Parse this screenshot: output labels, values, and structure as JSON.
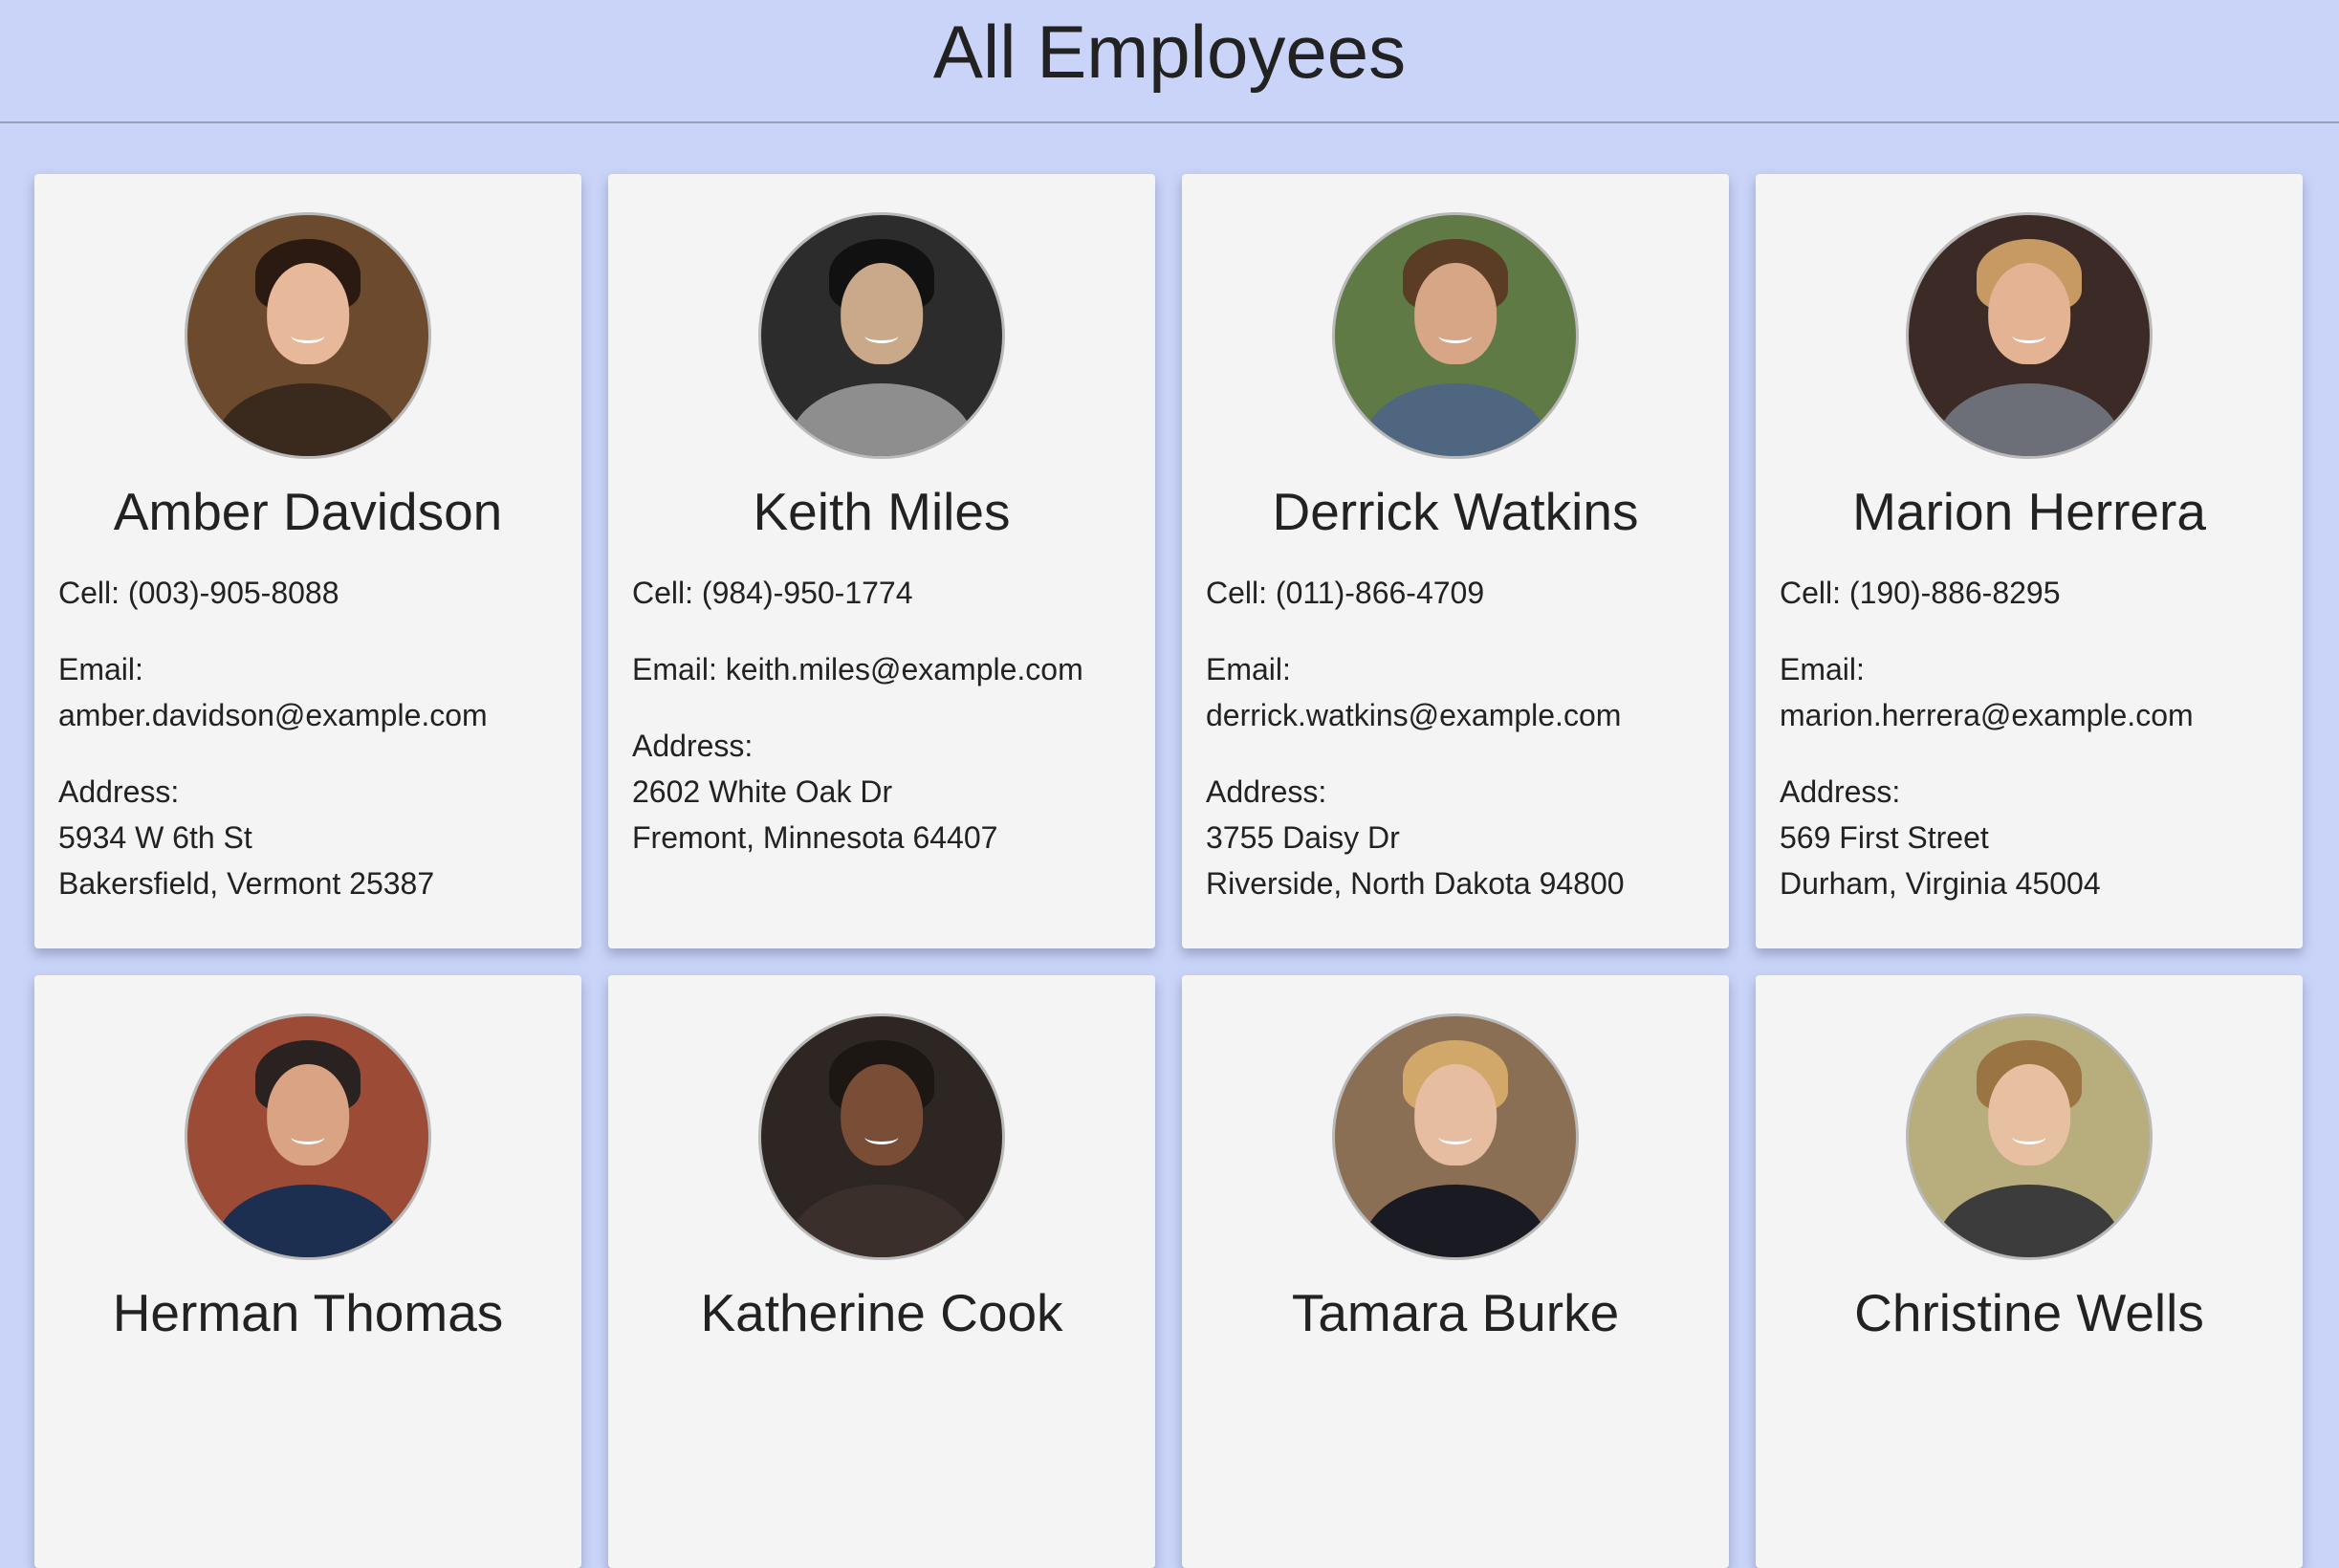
{
  "header": {
    "title": "All Employees"
  },
  "employees": [
    {
      "name": "Amber Davidson",
      "cell": "Cell: (003)-905-8088",
      "email_label": "Email:",
      "email": "amber.davidson@example.com",
      "email_break": true,
      "address_label": "Address:",
      "address_line1": "5934 W 6th St",
      "address_line2": "Bakersfield, Vermont 25387",
      "photo": {
        "bg": "#6b4a2e",
        "face": "#e7b89a",
        "hair": "#2b1a12",
        "body": "#3a2a1e"
      }
    },
    {
      "name": "Keith Miles",
      "cell": "Cell: (984)-950-1774",
      "email_label": "Email:",
      "email": "keith.miles@example.com",
      "email_break": false,
      "address_label": "Address:",
      "address_line1": "2602 White Oak Dr",
      "address_line2": "Fremont, Minnesota 64407",
      "photo": {
        "bg": "#2c2c2c",
        "face": "#c9a98a",
        "hair": "#111111",
        "body": "#8e8e8e"
      }
    },
    {
      "name": "Derrick Watkins",
      "cell": "Cell: (011)-866-4709",
      "email_label": "Email:",
      "email": "derrick.watkins@example.com",
      "email_break": true,
      "address_label": "Address:",
      "address_line1": "3755 Daisy Dr",
      "address_line2": "Riverside, North Dakota 94800",
      "photo": {
        "bg": "#5f7a45",
        "face": "#d7a686",
        "hair": "#5a3d24",
        "body": "#4e6680"
      }
    },
    {
      "name": "Marion Herrera",
      "cell": "Cell: (190)-886-8295",
      "email_label": "Email:",
      "email": "marion.herrera@example.com",
      "email_break": true,
      "address_label": "Address:",
      "address_line1": "569 First Street",
      "address_line2": "Durham, Virginia 45004",
      "photo": {
        "bg": "#3b2a26",
        "face": "#e3b394",
        "hair": "#c79a64",
        "body": "#6d6f78"
      }
    },
    {
      "name": "Herman Thomas",
      "photo": {
        "bg": "#9c4b36",
        "face": "#d9a384",
        "hair": "#2a2220",
        "body": "#1d2f50"
      }
    },
    {
      "name": "Katherine Cook",
      "photo": {
        "bg": "#2e2622",
        "face": "#7a4d36",
        "hair": "#1d1714",
        "body": "#3a2f2b"
      }
    },
    {
      "name": "Tamara Burke",
      "photo": {
        "bg": "#8a6f55",
        "face": "#e6bda0",
        "hair": "#d2a86a",
        "body": "#1a1a22"
      }
    },
    {
      "name": "Christine Wells",
      "photo": {
        "bg": "#b7ad7d",
        "face": "#e7c0a2",
        "hair": "#9b7444",
        "body": "#3c3c3c"
      }
    }
  ]
}
